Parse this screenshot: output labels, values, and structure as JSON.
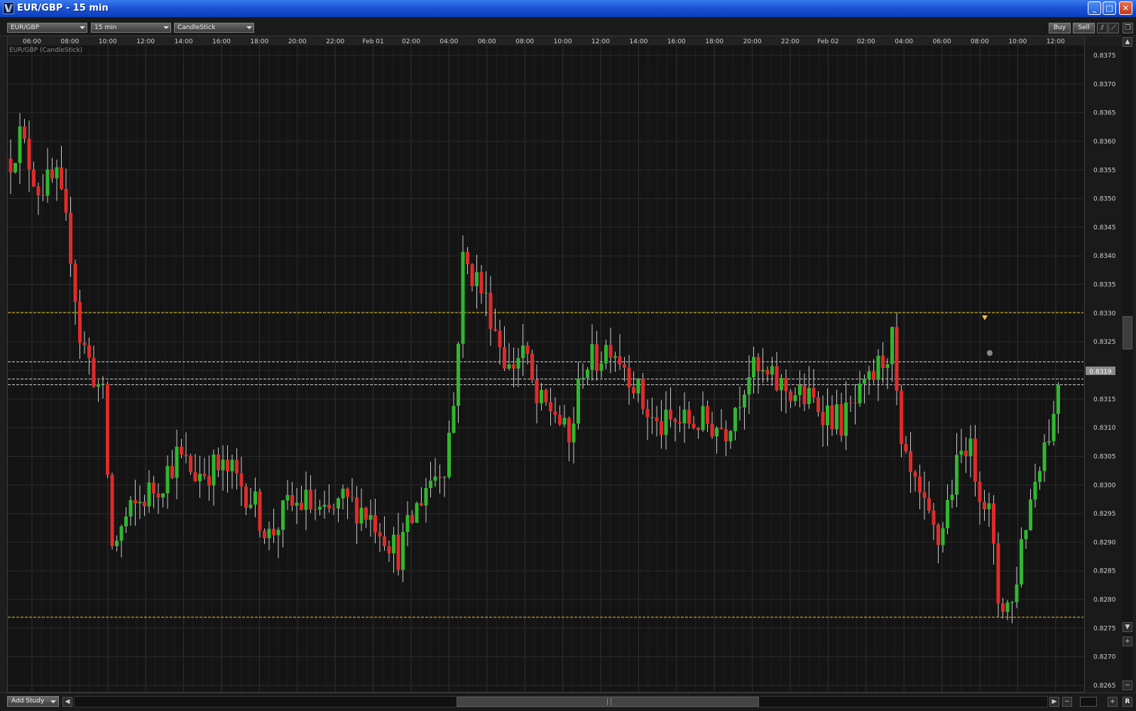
{
  "window": {
    "title": "EUR/GBP - 15 min",
    "buttons": {
      "minimize": "_",
      "maximize": "□",
      "close": "✕"
    },
    "titlebar_color": "#0b3fbf",
    "icon": "app-logo-icon"
  },
  "toolbar": {
    "symbol": "EUR/GBP",
    "timeframe": "15 min",
    "chart_type": "CandleStick",
    "buy_label": "Buy",
    "sell_label": "Sell"
  },
  "chart": {
    "legend": "EUR/GBP (CandleStick)",
    "current_price": "0.8319",
    "colors": {
      "background": "#141414",
      "grid": "#2a2a2a",
      "up": "#2eb82e",
      "down": "#e02a2a",
      "wick": "#c8c8c8",
      "level_line": "#e2c32a",
      "price_line": "#cfcfcf"
    }
  },
  "statusbar": {
    "add_study": "Add Study",
    "reset": "R"
  },
  "chart_data": {
    "type": "candlestick",
    "title": "EUR/GBP (CandleStick)",
    "interval": "15 min",
    "x_tick_labels": [
      "06:00",
      "08:00",
      "10:00",
      "12:00",
      "14:00",
      "16:00",
      "18:00",
      "20:00",
      "22:00",
      "Feb 01",
      "02:00",
      "04:00",
      "06:00",
      "08:00",
      "10:00",
      "12:00",
      "14:00",
      "16:00",
      "18:00",
      "20:00",
      "22:00",
      "Feb 02",
      "02:00",
      "04:00",
      "06:00",
      "08:00",
      "10:00",
      "12:00"
    ],
    "y_tick_labels": [
      "0.8375",
      "0.8370",
      "0.8365",
      "0.8360",
      "0.8355",
      "0.8350",
      "0.8345",
      "0.8340",
      "0.8335",
      "0.8330",
      "0.8325",
      "0.8320",
      "0.8315",
      "0.8310",
      "0.8305",
      "0.8300",
      "0.8295",
      "0.8290",
      "0.8285",
      "0.8280",
      "0.8275",
      "0.8270",
      "0.8265"
    ],
    "y_min": 0.8265,
    "y_max": 0.8375,
    "horizontal_levels": [
      0.83301,
      0.82769
    ],
    "price_lines": [
      0.83215,
      0.83185,
      0.83175
    ],
    "last_price": 0.8319,
    "grid": true,
    "anchors": [
      [
        0,
        0.8357
      ],
      [
        2,
        0.8361
      ],
      [
        6,
        0.8352
      ],
      [
        10,
        0.8353
      ],
      [
        13,
        0.8341
      ],
      [
        15,
        0.8326
      ],
      [
        20,
        0.8315
      ],
      [
        22,
        0.8289
      ],
      [
        25,
        0.8294
      ],
      [
        29,
        0.8298
      ],
      [
        32,
        0.83
      ],
      [
        36,
        0.8305
      ],
      [
        40,
        0.8302
      ],
      [
        44,
        0.8303
      ],
      [
        48,
        0.8302
      ],
      [
        52,
        0.8298
      ],
      [
        56,
        0.8291
      ],
      [
        60,
        0.8296
      ],
      [
        64,
        0.8297
      ],
      [
        68,
        0.8294
      ],
      [
        72,
        0.8297
      ],
      [
        76,
        0.8296
      ],
      [
        80,
        0.8293
      ],
      [
        84,
        0.8288
      ],
      [
        86,
        0.8292
      ],
      [
        90,
        0.83
      ],
      [
        94,
        0.8304
      ],
      [
        96,
        0.8314
      ],
      [
        98,
        0.8339
      ],
      [
        101,
        0.8336
      ],
      [
        104,
        0.833
      ],
      [
        108,
        0.832
      ],
      [
        111,
        0.8324
      ],
      [
        114,
        0.8314
      ],
      [
        118,
        0.8313
      ],
      [
        121,
        0.8307
      ],
      [
        124,
        0.8321
      ],
      [
        127,
        0.8322
      ],
      [
        130,
        0.8325
      ],
      [
        134,
        0.832
      ],
      [
        137,
        0.8314
      ],
      [
        140,
        0.831
      ],
      [
        145,
        0.8311
      ],
      [
        150,
        0.8311
      ],
      [
        155,
        0.831
      ],
      [
        160,
        0.832
      ],
      [
        165,
        0.8318
      ],
      [
        170,
        0.8316
      ],
      [
        175,
        0.8314
      ],
      [
        180,
        0.8311
      ],
      [
        185,
        0.8316
      ],
      [
        191,
        0.8325
      ],
      [
        193,
        0.8305
      ],
      [
        198,
        0.8295
      ],
      [
        201,
        0.829
      ],
      [
        204,
        0.83
      ],
      [
        207,
        0.8308
      ],
      [
        210,
        0.83
      ],
      [
        212,
        0.8295
      ],
      [
        214,
        0.828
      ],
      [
        217,
        0.8279
      ],
      [
        219,
        0.829
      ],
      [
        223,
        0.8305
      ],
      [
        226,
        0.8312
      ],
      [
        228,
        0.8325
      ],
      [
        231,
        0.832
      ],
      [
        233,
        0.8316
      ],
      [
        235,
        0.8326
      ],
      [
        238,
        0.8317
      ],
      [
        242,
        0.8318
      ],
      [
        245,
        0.832
      ]
    ]
  }
}
